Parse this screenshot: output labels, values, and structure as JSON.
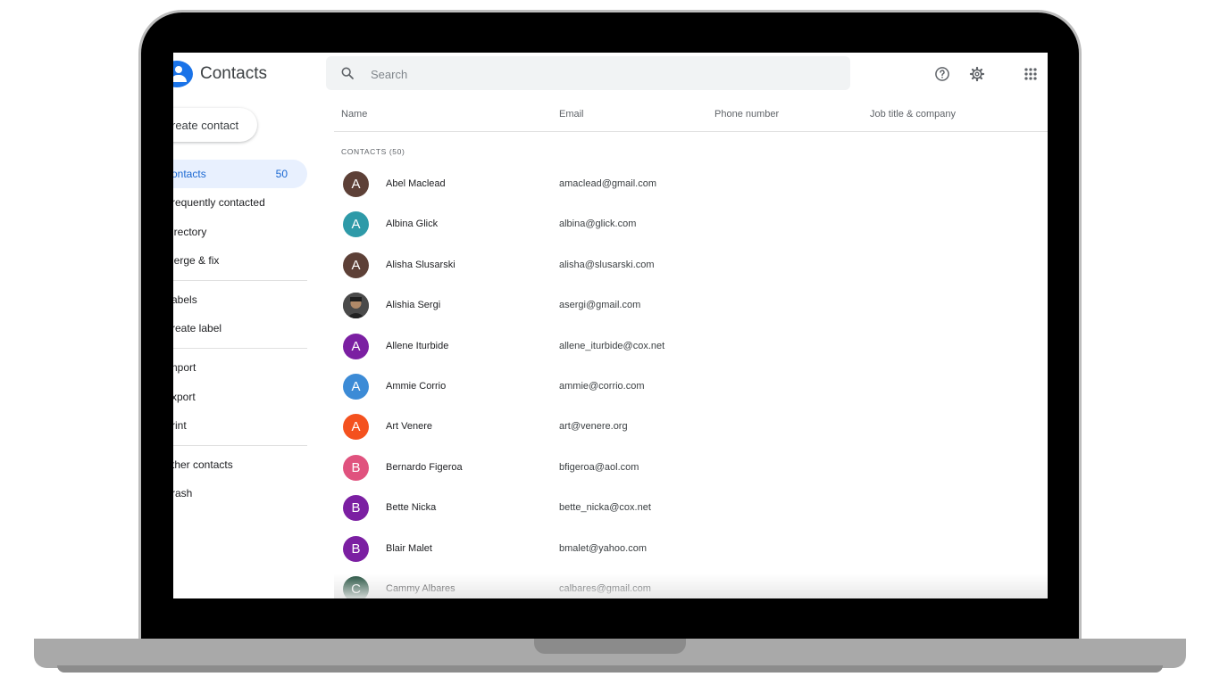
{
  "app": {
    "title": "Contacts"
  },
  "sidebar": {
    "create_label": "reate contact",
    "items": [
      {
        "label": "ontacts",
        "count": "50",
        "active": true
      },
      {
        "label": "requently contacted"
      },
      {
        "label": "irectory"
      },
      {
        "label": "lerge & fix"
      },
      {
        "label": "abels"
      },
      {
        "label": "reate label"
      },
      {
        "label": "nport"
      },
      {
        "label": "xport"
      },
      {
        "label": "rint"
      },
      {
        "label": "ther contacts"
      },
      {
        "label": "rash"
      }
    ]
  },
  "search": {
    "placeholder": "Search"
  },
  "toolbar": {
    "icons": [
      "help-icon",
      "settings-gear-icon",
      "apps-grid-icon"
    ]
  },
  "table": {
    "columns": [
      "Name",
      "Email",
      "Phone number",
      "Job title & company"
    ],
    "section_label": "CONTACTS (50)",
    "rows": [
      {
        "initial": "A",
        "name": "Abel Maclead",
        "email": "amaclead@gmail.com",
        "color": "#5d4037"
      },
      {
        "initial": "A",
        "name": "Albina Glick",
        "email": "albina@glick.com",
        "color": "#2e9aa8"
      },
      {
        "initial": "A",
        "name": "Alisha Slusarski",
        "email": "alisha@slusarski.com",
        "color": "#5d4037"
      },
      {
        "initial": "",
        "name": "Alishia Sergi",
        "email": "asergi@gmail.com",
        "color": "#3a3a3a",
        "photo": true
      },
      {
        "initial": "A",
        "name": "Allene Iturbide",
        "email": "allene_iturbide@cox.net",
        "color": "#7b1fa2"
      },
      {
        "initial": "A",
        "name": "Ammie Corrio",
        "email": "ammie@corrio.com",
        "color": "#3c8bd6"
      },
      {
        "initial": "A",
        "name": "Art Venere",
        "email": "art@venere.org",
        "color": "#f4511e"
      },
      {
        "initial": "B",
        "name": "Bernardo Figeroa",
        "email": "bfigeroa@aol.com",
        "color": "#e0527e"
      },
      {
        "initial": "B",
        "name": "Bette Nicka",
        "email": "bette_nicka@cox.net",
        "color": "#7b1fa2"
      },
      {
        "initial": "B",
        "name": "Blair Malet",
        "email": "bmalet@yahoo.com",
        "color": "#7b1fa2"
      },
      {
        "initial": "C",
        "name": "Cammy Albares",
        "email": "calbares@gmail.com",
        "color": "#1e4d3a"
      }
    ]
  }
}
